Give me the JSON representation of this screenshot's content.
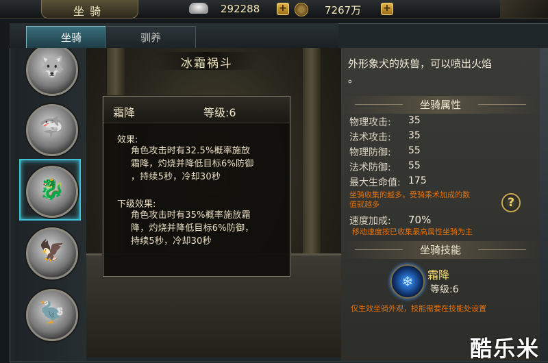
{
  "header": {
    "title": "坐骑",
    "silver": "292288",
    "gold": "7267万",
    "add_label": "+"
  },
  "tabs": [
    {
      "label": "坐骑",
      "active": true
    },
    {
      "label": "驯养",
      "active": false
    }
  ],
  "mounts": [
    {
      "icon": "white-wolf-mount-icon",
      "selected": false
    },
    {
      "icon": "grey-beast-mount-icon",
      "selected": false
    },
    {
      "icon": "ice-dragon-mount-icon",
      "selected": true
    },
    {
      "icon": "white-eagle-mount-icon",
      "selected": false
    },
    {
      "icon": "silver-griffin-mount-icon",
      "selected": false
    }
  ],
  "preview": {
    "mount_name": "冰霜祸斗"
  },
  "tooltip": {
    "skill_name": "霜降",
    "level": "等级:6",
    "effect_label": "效果:",
    "effect_lines": [
      "角色攻击时有32.5%概率施放",
      "霜降，灼烧并降低目标6%防御",
      "，持续5秒，冷却30秒"
    ],
    "next_label": "下级效果:",
    "next_lines": [
      "角色攻击时有35%概率施放霜",
      "降，灼烧并降低目标6%防御，",
      "持续5秒，冷却30秒"
    ]
  },
  "info": {
    "description_line1": "外形象犬的妖兽，可以喷出火焰",
    "description_line2": "。",
    "attributes_header": "坐骑属性",
    "stats": [
      {
        "label": "物理攻击:",
        "value": "35"
      },
      {
        "label": "法术攻击:",
        "value": "35"
      },
      {
        "label": "物理防御:",
        "value": "55"
      },
      {
        "label": "法术防御:",
        "value": "55"
      },
      {
        "label": "最大生命值:",
        "value": "175"
      }
    ],
    "hp_note_line1": "坐骑收集的越多，受骑乘术加成的数",
    "hp_note_line2": "值就越多",
    "help_label": "?",
    "speed_label": "速度加成:",
    "speed_value": "70%",
    "speed_note": "移动速度按已收集最高属性坐骑为主",
    "skills_header": "坐骑技能",
    "skill_name": "霜降",
    "skill_level": "等级:6",
    "skill_note": "仅生效坐骑外观，技能需要在技能处设置"
  },
  "watermark": "酷乐米",
  "colors": {
    "accent_cyan": "#3fc2d8",
    "note_orange": "#e2720e",
    "skill_gold": "#f4d873"
  }
}
